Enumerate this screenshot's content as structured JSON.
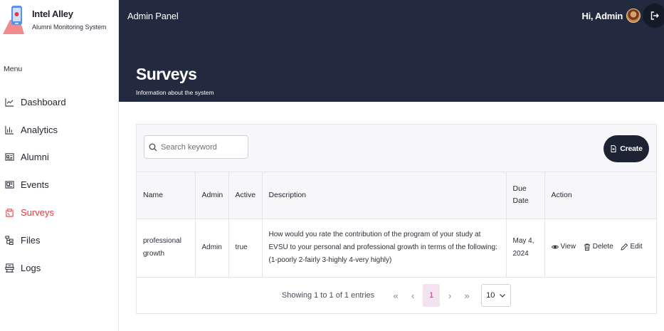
{
  "brand": {
    "name": "Intel Alley",
    "subtitle": "Alumni Monitoring System"
  },
  "sidebar": {
    "menu_title": "Menu",
    "items": [
      {
        "label": "Dashboard",
        "icon": "chart-line-icon",
        "active": false
      },
      {
        "label": "Analytics",
        "icon": "bar-chart-icon",
        "active": false
      },
      {
        "label": "Alumni",
        "icon": "id-card-icon",
        "active": false
      },
      {
        "label": "Events",
        "icon": "newspaper-icon",
        "active": false
      },
      {
        "label": "Surveys",
        "icon": "clipboard-icon",
        "active": true
      },
      {
        "label": "Files",
        "icon": "folder-tree-icon",
        "active": false
      },
      {
        "label": "Logs",
        "icon": "archive-icon",
        "active": false
      }
    ]
  },
  "header": {
    "panel_label": "Admin Panel",
    "greeting": "Hi, Admin",
    "page_title": "Surveys",
    "page_subtitle": "Information about the system"
  },
  "toolbar": {
    "search_placeholder": "Search keyword",
    "create_label": "Create"
  },
  "table": {
    "columns": [
      "Name",
      "Admin",
      "Active",
      "Description",
      "Due Date",
      "Action"
    ],
    "rows": [
      {
        "name": "professional growth",
        "admin": "Admin",
        "active": "true",
        "description": "How would you rate the contribution of the program of your study at EVSU to your personal and professional growth in terms of the following: (1-poorly 2-fairly 3-highly 4-very highly)",
        "due_date": "May 4, 2024",
        "actions": {
          "view": "View",
          "delete": "Delete",
          "edit": "Edit"
        }
      }
    ]
  },
  "pagination": {
    "info": "Showing 1 to 1 of 1 entries",
    "first": "«",
    "prev": "‹",
    "current_page": "1",
    "next": "›",
    "last": "»",
    "per_page": "10"
  },
  "colors": {
    "header_bg": "#212a3e",
    "accent": "#e03a3e",
    "button_dark": "#1c2333",
    "current_page_bg": "#f3e3f1"
  }
}
